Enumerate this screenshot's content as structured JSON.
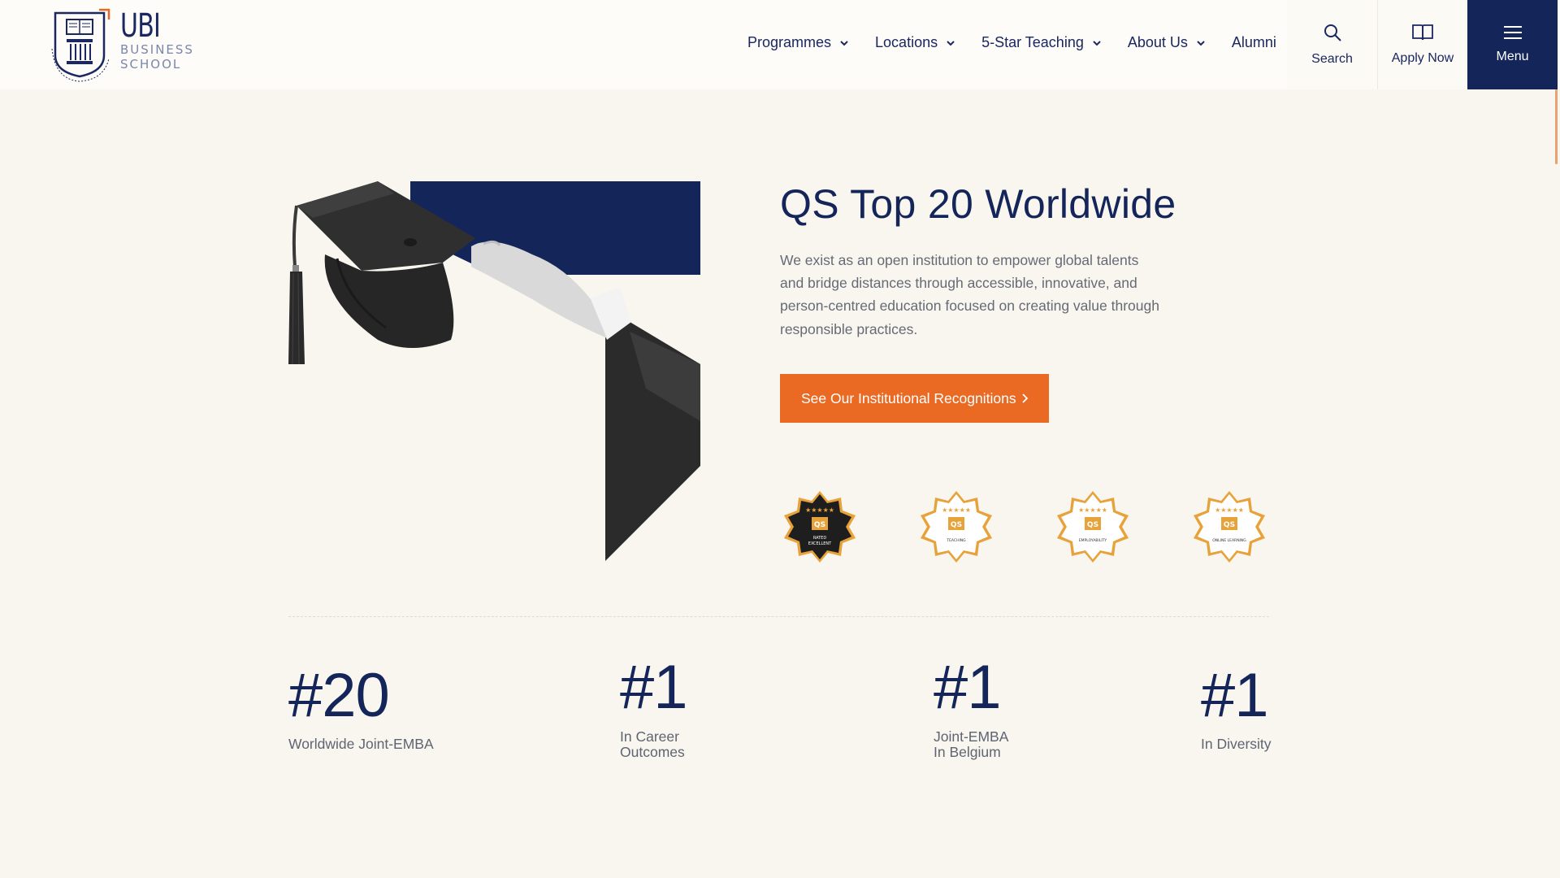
{
  "header": {
    "logo": {
      "wordmark": "UBI",
      "line1": "BUSINESS",
      "line2": "SCHOOL",
      "seal_text": "UNITED BUSINESS INSTITUTES"
    },
    "nav": [
      {
        "label": "Programmes",
        "has_dropdown": true
      },
      {
        "label": "Locations",
        "has_dropdown": true
      },
      {
        "label": "5-Star Teaching",
        "has_dropdown": true
      },
      {
        "label": "About Us",
        "has_dropdown": true
      },
      {
        "label": "Alumni",
        "has_dropdown": false
      }
    ],
    "search_label": "Search",
    "apply_label": "Apply Now",
    "menu_label": "Menu"
  },
  "hero": {
    "title": "QS Top 20 Worldwide",
    "description": "We exist as an open institution to empower global talents and bridge distances through accessible, innovative, and person-centred education focused on creating value through responsible practices.",
    "cta_label": "See Our Institutional Recognitions",
    "image_icon": "graduation-cap-photo",
    "badges": [
      {
        "brand": "QS",
        "stars": 5,
        "caption": "RATED EXCELLENT",
        "theme": "dark"
      },
      {
        "brand": "QS",
        "stars": 5,
        "caption": "TEACHING",
        "theme": "light"
      },
      {
        "brand": "QS",
        "stars": 5,
        "caption": "EMPLOYABILITY",
        "theme": "light"
      },
      {
        "brand": "QS",
        "stars": 5,
        "caption": "ONLINE LEARNING",
        "theme": "light"
      }
    ]
  },
  "stats": [
    {
      "value": "#20",
      "label": [
        "Worldwide Joint-EMBA"
      ]
    },
    {
      "value": "#1",
      "label": [
        "In Career",
        "Outcomes"
      ]
    },
    {
      "value": "#1",
      "label": [
        "Joint-EMBA",
        "In Belgium"
      ]
    },
    {
      "value": "#1",
      "label": [
        "In Diversity"
      ]
    }
  ],
  "colors": {
    "navy": "#14255a",
    "accent_orange": "#ea6a24",
    "background": "#f8f6ef",
    "badge_gold": "#e8a23a"
  }
}
